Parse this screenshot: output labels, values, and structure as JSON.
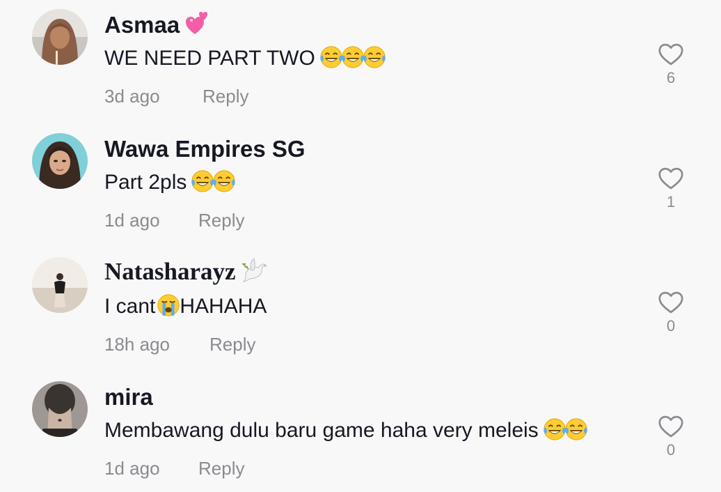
{
  "comments": [
    {
      "username": "Asmaa",
      "username_emoji": "sparkling-heart",
      "text": "WE NEED PART TWO",
      "text_emojis": [
        "face-with-tears-of-joy",
        "face-with-tears-of-joy",
        "face-with-tears-of-joy"
      ],
      "time": "3d ago",
      "reply_label": "Reply",
      "likes": "6"
    },
    {
      "username": "Wawa Empires SG",
      "text": "Part 2pls",
      "text_emojis": [
        "face-with-tears-of-joy",
        "face-with-tears-of-joy"
      ],
      "time": "1d ago",
      "reply_label": "Reply",
      "likes": "1"
    },
    {
      "username": "Natasharayz",
      "username_emoji": "dove",
      "text_before": "I cant",
      "text_emoji": "loudly-crying-face",
      "text_after": "HAHAHA",
      "time": "18h ago",
      "reply_label": "Reply",
      "likes": "0"
    },
    {
      "username": "mira",
      "text": "Membawang dulu baru game haha very meleis",
      "text_emojis": [
        "face-with-tears-of-joy",
        "face-with-tears-of-joy"
      ],
      "time": "1d ago",
      "reply_label": "Reply",
      "likes": "0"
    }
  ],
  "colors": {
    "background": "#f8f8f8",
    "text_primary": "#161823",
    "text_secondary": "#8a8b91"
  }
}
